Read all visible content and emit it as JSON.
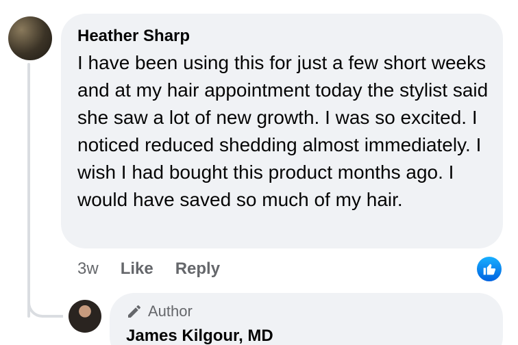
{
  "comment": {
    "author": "Heather Sharp",
    "text": "I have been using this for just a few short weeks and at my hair appointment today the stylist said she saw a lot of new growth. I was so excited. I noticed reduced shedding almost immediately. I wish I had bought this product months ago. I would have saved so much of my hair.",
    "time": "3w",
    "like_label": "Like",
    "reply_label": "Reply",
    "reaction_icon": "thumbs-up-icon",
    "reaction_color": "#1877f2"
  },
  "reply": {
    "badge_icon": "pencil-icon",
    "badge_label": "Author",
    "author": "James Kilgour, MD"
  },
  "colors": {
    "bubble_bg": "#f0f2f5",
    "muted_text": "#65676b",
    "thread_line": "#dadde1"
  }
}
